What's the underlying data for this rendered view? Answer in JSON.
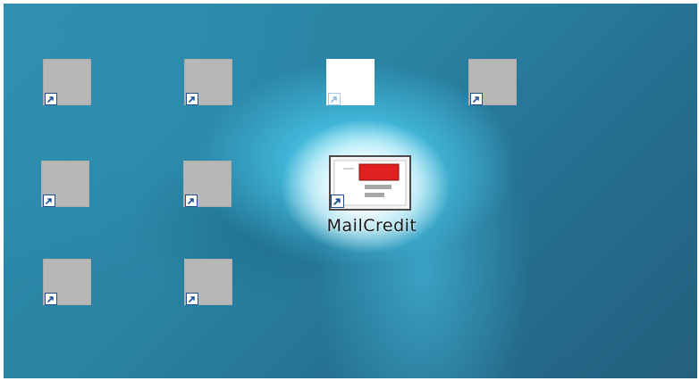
{
  "desktop": {
    "icons": [
      {
        "name": "desktop-shortcut-1",
        "shortcut_icon": "shortcut-arrow-icon"
      },
      {
        "name": "desktop-shortcut-2",
        "shortcut_icon": "shortcut-arrow-icon"
      },
      {
        "name": "desktop-shortcut-3",
        "shortcut_icon": "shortcut-arrow-icon"
      },
      {
        "name": "desktop-shortcut-4",
        "shortcut_icon": "shortcut-arrow-icon"
      },
      {
        "name": "desktop-shortcut-5",
        "shortcut_icon": "shortcut-arrow-icon"
      },
      {
        "name": "desktop-shortcut-6",
        "shortcut_icon": "shortcut-arrow-icon"
      },
      {
        "name": "desktop-shortcut-7",
        "shortcut_icon": "shortcut-arrow-icon"
      },
      {
        "name": "desktop-shortcut-8",
        "shortcut_icon": "shortcut-arrow-icon"
      },
      {
        "name": "desktop-shortcut-9",
        "shortcut_icon": "shortcut-arrow-icon"
      }
    ],
    "featured": {
      "label": "MailCredit",
      "icon": "mail-credit-card-icon",
      "shortcut_icon": "shortcut-arrow-icon"
    }
  },
  "colors": {
    "desktop_background": "#2f8fae",
    "highlight_glow": "#9fe9fb",
    "placeholder_tile": "#b7b7b7",
    "card_red": "#e02020",
    "shortcut_arrow": "#1f4f96"
  }
}
